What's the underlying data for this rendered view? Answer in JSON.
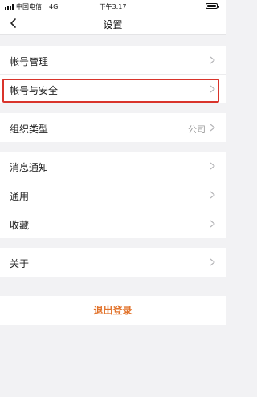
{
  "status_bar": {
    "carrier": "中国电信",
    "network": "4G",
    "time": "下午3:17"
  },
  "nav": {
    "title": "设置"
  },
  "groups": [
    {
      "items": [
        {
          "label": "帐号管理"
        },
        {
          "label": "帐号与安全"
        }
      ]
    },
    {
      "items": [
        {
          "label": "组织类型",
          "value": "公司"
        }
      ]
    },
    {
      "items": [
        {
          "label": "消息通知"
        },
        {
          "label": "通用"
        },
        {
          "label": "收藏"
        }
      ]
    },
    {
      "items": [
        {
          "label": "关于"
        }
      ]
    }
  ],
  "logout": {
    "label": "退出登录"
  },
  "colors": {
    "highlight": "#d9342b",
    "logout_text": "#e2742d",
    "background": "#f2f2f4"
  },
  "icons": {
    "back": "chevron-left-icon",
    "row_arrow": "chevron-right-icon",
    "battery": "battery-icon",
    "signal": "signal-icon"
  }
}
